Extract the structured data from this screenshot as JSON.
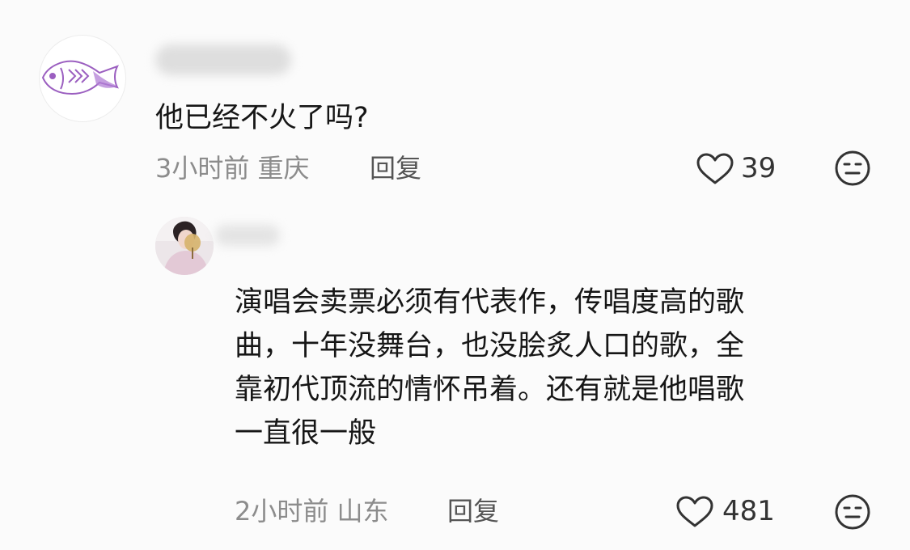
{
  "comments": [
    {
      "username": "用户",
      "text": "他已经不火了吗?",
      "time_location": "3小时前 重庆",
      "reply_label": "回复",
      "like_count": "39"
    },
    {
      "username": "用户",
      "text": "演唱会卖票必须有代表作，传唱度高的歌\n曲，十年没舞台，也没脍炙人口的歌，全\n靠初代顶流的情怀吊着。还有就是他唱歌\n一直很一般",
      "time_location": "2小时前 山东",
      "reply_label": "回复",
      "like_count": "481"
    }
  ],
  "icons": {
    "avatar1": "fish-icon",
    "like": "heart-outline-icon",
    "dislike": "unamused-face-icon"
  },
  "colors": {
    "background": "#fbfbfb",
    "text": "#161616",
    "meta": "#8c8c8c",
    "fish_accent": "#9b5fc0"
  }
}
